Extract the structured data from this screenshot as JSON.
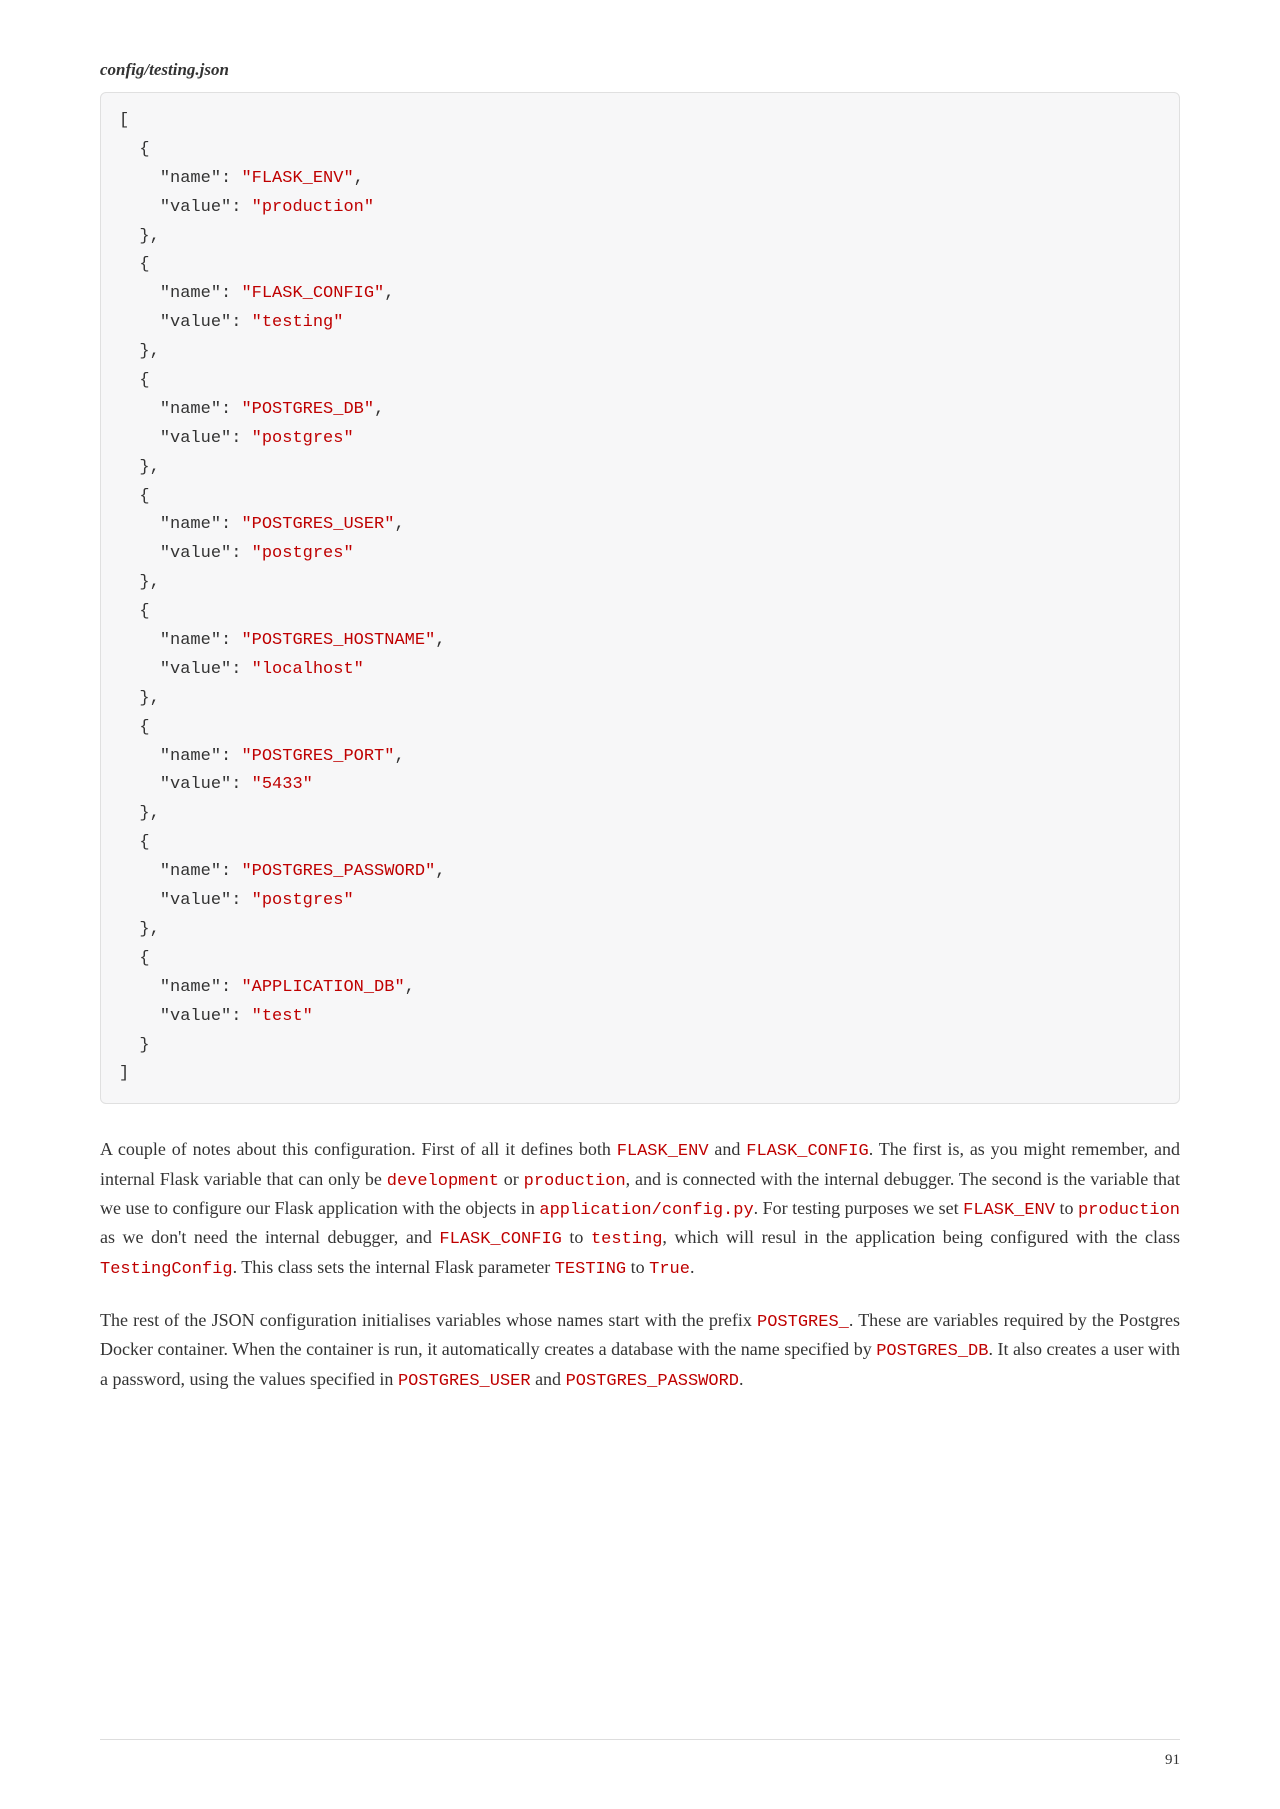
{
  "file_title": "config/testing.json",
  "code": {
    "entries": [
      {
        "name": "FLASK_ENV",
        "value": "production"
      },
      {
        "name": "FLASK_CONFIG",
        "value": "testing"
      },
      {
        "name": "POSTGRES_DB",
        "value": "postgres"
      },
      {
        "name": "POSTGRES_USER",
        "value": "postgres"
      },
      {
        "name": "POSTGRES_HOSTNAME",
        "value": "localhost"
      },
      {
        "name": "POSTGRES_PORT",
        "value": "5433"
      },
      {
        "name": "POSTGRES_PASSWORD",
        "value": "postgres"
      },
      {
        "name": "APPLICATION_DB",
        "value": "test"
      }
    ]
  },
  "para1": {
    "t0": "A couple of notes about this configuration. First of all it defines both ",
    "c0": "FLASK_ENV",
    "t1": " and ",
    "c1": "FLASK_CONFIG",
    "t2": ". The first is, as you might remember, and internal Flask variable that can only be ",
    "c2": "development",
    "t3": " or ",
    "c3": "production",
    "t4": ", and is connected with the internal debugger. The second is the variable that we use to configure our Flask application with the objects in ",
    "c4": "application/config.py",
    "t5": ". For testing purposes we set ",
    "c5": "FLASK_ENV",
    "t6": " to ",
    "c6": "production",
    "t7": " as we don't need the internal debugger, and ",
    "c7": "FLASK_CONFIG",
    "t8": " to ",
    "c8": "testing",
    "t9": ", which will resul in the application being configured with the class ",
    "c9": "TestingConfig",
    "t10": ". This class sets the internal Flask parameter ",
    "c10": "TESTING",
    "t11": " to ",
    "c11": "True",
    "t12": "."
  },
  "para2": {
    "t0": "The rest of the JSON configuration initialises variables whose names start with the prefix ",
    "c0": "POSTGRES_",
    "t1": ". These are variables required by the Postgres Docker container. When the container is run, it automatically creates a database with the name specified by ",
    "c1": "POSTGRES_DB",
    "t2": ". It also creates a user with a password, using the values specified in ",
    "c2": "POSTGRES_USER",
    "t3": " and ",
    "c3": "POSTGRES_PASSWORD",
    "t4": "."
  },
  "page_number": "91"
}
